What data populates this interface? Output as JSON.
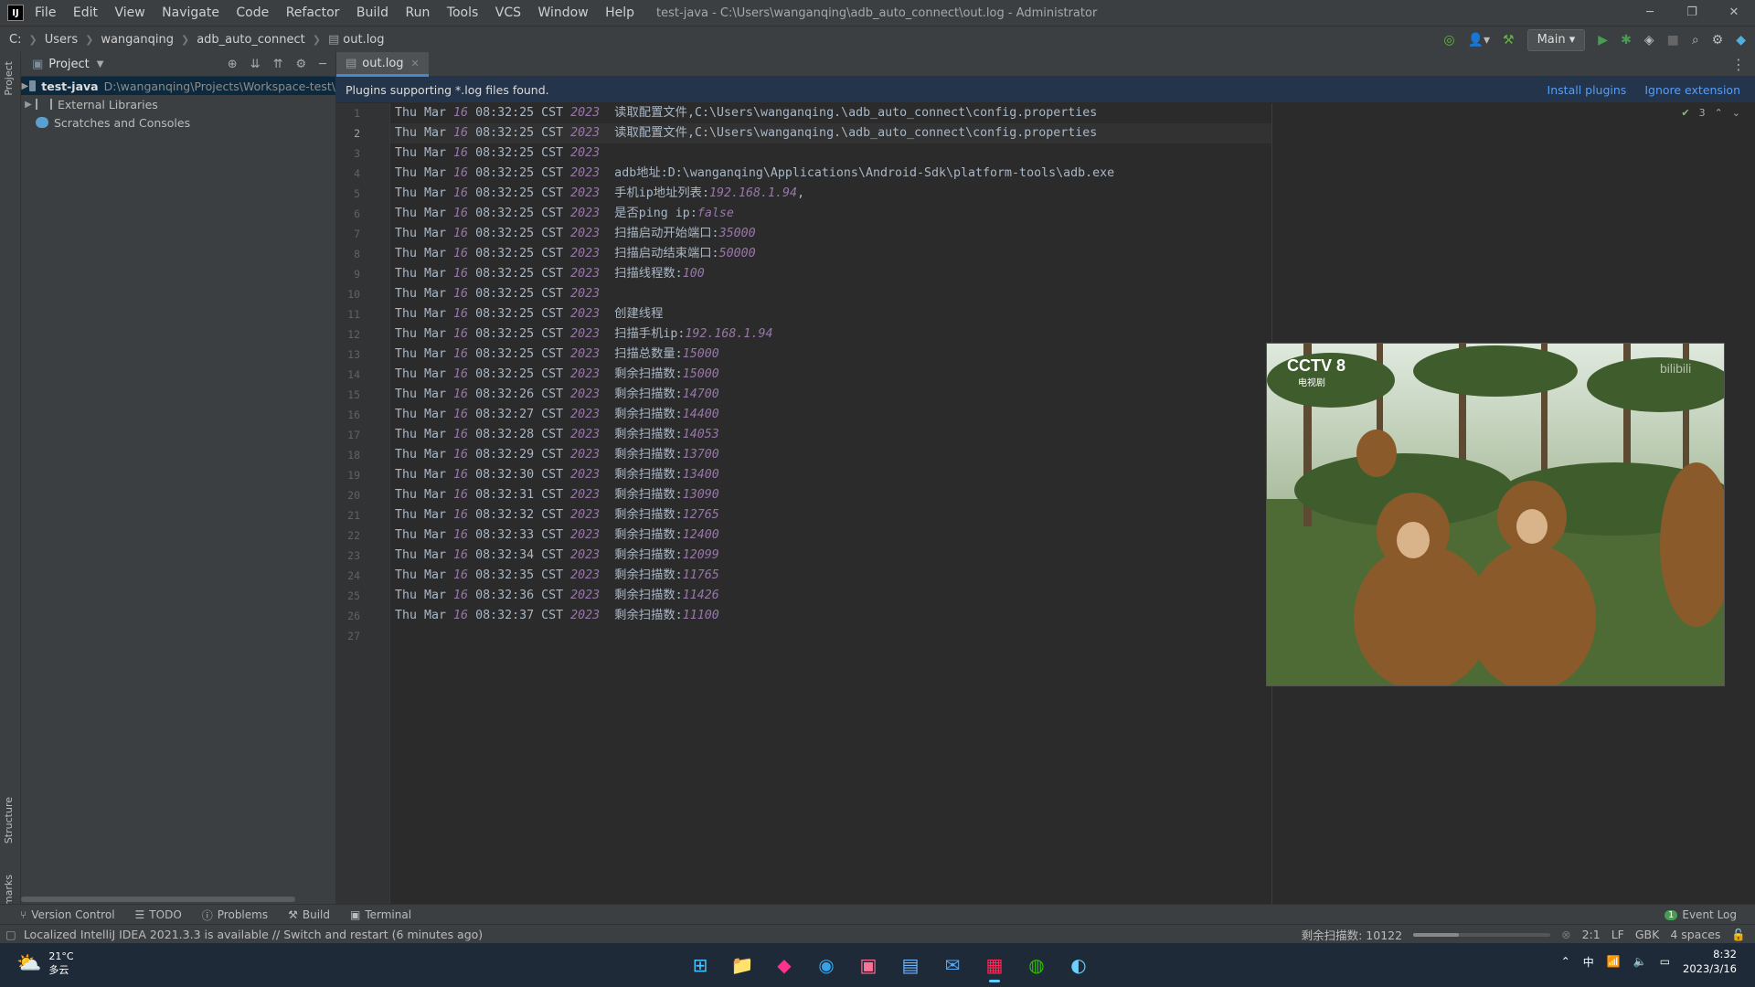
{
  "titlebar": {
    "logo": "IJ",
    "menu": [
      "File",
      "Edit",
      "View",
      "Navigate",
      "Code",
      "Refactor",
      "Build",
      "Run",
      "Tools",
      "VCS",
      "Window",
      "Help"
    ],
    "window_title": "test-java - C:\\Users\\wanganqing\\adb_auto_connect\\out.log - Administrator"
  },
  "navbar": {
    "crumbs": [
      "C:",
      "Users",
      "wanganqing",
      "adb_auto_connect",
      "out.log"
    ],
    "run_config": "Main"
  },
  "left_strip": {
    "project": "Project",
    "structure": "Structure",
    "bookmarks": "Bookmarks"
  },
  "project_panel": {
    "title": "Project",
    "items": [
      {
        "label": "test-java",
        "path": "D:\\wanganqing\\Projects\\Workspace-test\\"
      },
      {
        "label": "External Libraries"
      },
      {
        "label": "Scratches and Consoles"
      }
    ]
  },
  "editor": {
    "tab": "out.log",
    "banner": "Plugins supporting *.log files found.",
    "install_plugins": "Install plugins",
    "ignore_extension": "Ignore extension",
    "inspect_count": "3",
    "lines": [
      {
        "t": "08:32:25",
        "m": "读取配置文件,C:\\Users\\wanganqing.\\adb_auto_connect\\config.properties",
        "v": ""
      },
      {
        "t": "08:32:25",
        "m": "读取配置文件,C:\\Users\\wanganqing.\\adb_auto_connect\\config.properties",
        "v": ""
      },
      {
        "t": "08:32:25",
        "m": "",
        "v": ""
      },
      {
        "t": "08:32:25",
        "m": "adb地址:D:\\wanganqing\\Applications\\Android-Sdk\\platform-tools\\adb.exe",
        "v": ""
      },
      {
        "t": "08:32:25",
        "m": "手机ip地址列表:",
        "v": "192.168.1.94",
        "s": ","
      },
      {
        "t": "08:32:25",
        "m": "是否ping ip:",
        "v": "false"
      },
      {
        "t": "08:32:25",
        "m": "扫描启动开始端口:",
        "v": "35000"
      },
      {
        "t": "08:32:25",
        "m": "扫描启动结束端口:",
        "v": "50000"
      },
      {
        "t": "08:32:25",
        "m": "扫描线程数:",
        "v": "100"
      },
      {
        "t": "08:32:25",
        "m": "",
        "v": ""
      },
      {
        "t": "08:32:25",
        "m": "创建线程",
        "v": ""
      },
      {
        "t": "08:32:25",
        "m": "扫描手机ip:",
        "v": "192.168.1.94"
      },
      {
        "t": "08:32:25",
        "m": "扫描总数量:",
        "v": "15000"
      },
      {
        "t": "08:32:25",
        "m": "剩余扫描数:",
        "v": "15000"
      },
      {
        "t": "08:32:26",
        "m": "剩余扫描数:",
        "v": "14700"
      },
      {
        "t": "08:32:27",
        "m": "剩余扫描数:",
        "v": "14400"
      },
      {
        "t": "08:32:28",
        "m": "剩余扫描数:",
        "v": "14053"
      },
      {
        "t": "08:32:29",
        "m": "剩余扫描数:",
        "v": "13700"
      },
      {
        "t": "08:32:30",
        "m": "剩余扫描数:",
        "v": "13400"
      },
      {
        "t": "08:32:31",
        "m": "剩余扫描数:",
        "v": "13090"
      },
      {
        "t": "08:32:32",
        "m": "剩余扫描数:",
        "v": "12765"
      },
      {
        "t": "08:32:33",
        "m": "剩余扫描数:",
        "v": "12400"
      },
      {
        "t": "08:32:34",
        "m": "剩余扫描数:",
        "v": "12099"
      },
      {
        "t": "08:32:35",
        "m": "剩余扫描数:",
        "v": "11765"
      },
      {
        "t": "08:32:36",
        "m": "剩余扫描数:",
        "v": "11426"
      },
      {
        "t": "08:32:37",
        "m": "剩余扫描数:",
        "v": "11100"
      }
    ],
    "line_prefix": {
      "day": "Thu",
      "mon": "Mar",
      "date": "16",
      "tz": "CST",
      "year": "2023"
    },
    "total_lines": 27,
    "current_line": 2
  },
  "video": {
    "channel": "CCTV 8",
    "sub": "电视剧",
    "watermark": "bilibili"
  },
  "toolwindows": {
    "items": [
      "Version Control",
      "TODO",
      "Problems",
      "Build",
      "Terminal"
    ],
    "event_log": "Event Log",
    "event_count": "1"
  },
  "status": {
    "message": "Localized IntelliJ IDEA 2021.3.3 is available // Switch and restart (6 minutes ago)",
    "task": "剩余扫描数: 10122",
    "progress": 0.33,
    "position": "2:1",
    "line_sep": "LF",
    "encoding": "GBK",
    "indent": "4 spaces"
  },
  "taskbar": {
    "temp": "21°C",
    "weather": "多云",
    "ime": "中",
    "time": "8:32",
    "date": "2023/3/16"
  }
}
